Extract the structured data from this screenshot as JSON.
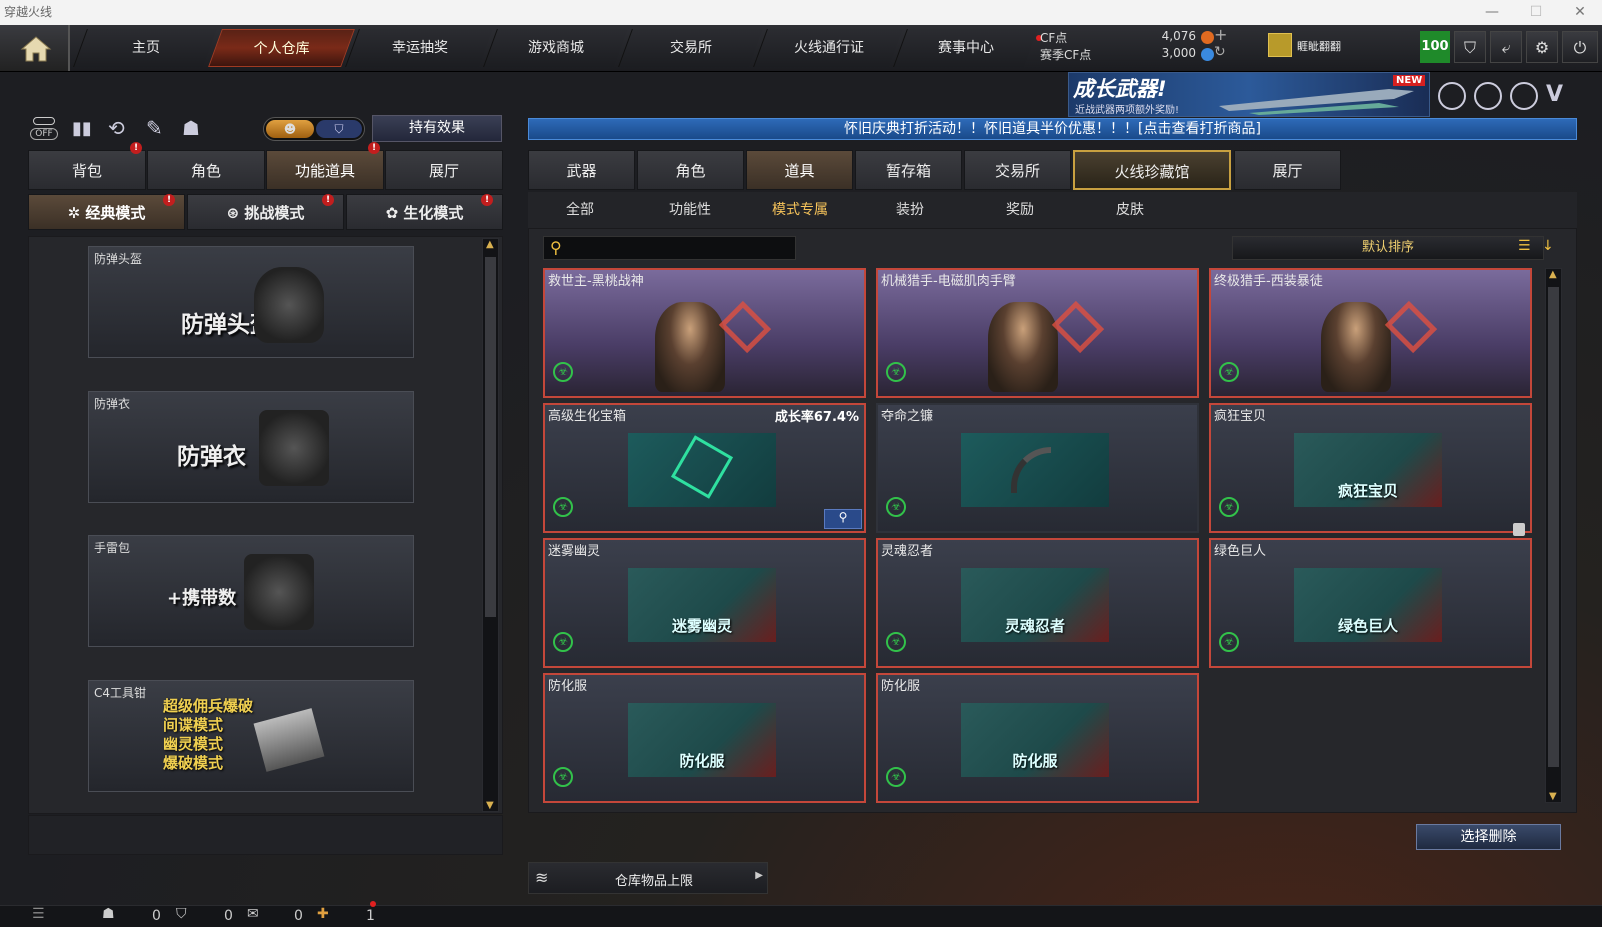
{
  "window": {
    "title": "穿越火线"
  },
  "nav": {
    "tabs": [
      "主页",
      "个人仓库",
      "幸运抽奖",
      "游戏商城",
      "交易所",
      "火线通行证",
      "赛事中心"
    ],
    "active": 1
  },
  "currency": {
    "cf_label": "CF点",
    "cf_value": "4,076",
    "match_label": "赛季CF点",
    "match_value": "3,000",
    "rank_name": "睚眦翻翻",
    "level": "100"
  },
  "banner": {
    "title": "成长武器!",
    "subtitle": "近战武器两项额外奖励!",
    "badge": "NEW"
  },
  "notice": "怀旧庆典打折活动！！怀旧道具半价优惠！！！[点击查看打折商品]",
  "left": {
    "hold_effect": "持有效果",
    "toggle_off": "OFF",
    "tabs": [
      "背包",
      "角色",
      "功能道具",
      "展厅"
    ],
    "modes": [
      "经典模式",
      "挑战模式",
      "生化模式"
    ],
    "cards": [
      {
        "label": "防弹头盔",
        "big": "防弹头盔"
      },
      {
        "label": "防弹衣",
        "big": "防弹衣"
      },
      {
        "label": "手雷包",
        "big": "+携带数"
      },
      {
        "label": "C4工具钳",
        "lines": [
          "超级佣兵爆破",
          "间谍模式",
          "幽灵模式",
          "爆破模式"
        ]
      }
    ]
  },
  "right": {
    "tabs": [
      "武器",
      "角色",
      "道具",
      "暂存箱",
      "交易所",
      "火线珍藏馆",
      "展厅"
    ],
    "subtabs": [
      "全部",
      "功能性",
      "模式专属",
      "装扮",
      "奖励",
      "皮肤"
    ],
    "sort": "默认排序",
    "search_placeholder": "",
    "items": [
      {
        "name": "救世主-黑桃战神",
        "type": "hero"
      },
      {
        "name": "机械猎手-电磁肌肉手臂",
        "type": "hero"
      },
      {
        "name": "终极猎手-西装暴徒",
        "type": "hero"
      },
      {
        "name": "高级生化宝箱",
        "rate": "成长率67.4%",
        "art": ""
      },
      {
        "name": "夺命之镰",
        "art": ""
      },
      {
        "name": "疯狂宝贝",
        "art": "疯狂宝贝"
      },
      {
        "name": "迷雾幽灵",
        "art": "迷雾幽灵"
      },
      {
        "name": "灵魂忍者",
        "art": "灵魂忍者"
      },
      {
        "name": "绿色巨人",
        "art": "绿色巨人"
      },
      {
        "name": "防化服",
        "art": "防化服"
      },
      {
        "name": "防化服",
        "art": "防化服"
      }
    ],
    "delete_btn": "选择删除",
    "capacity": "仓库物品上限"
  },
  "bottom": {
    "counts": [
      "0",
      "0",
      "0",
      "1"
    ]
  }
}
